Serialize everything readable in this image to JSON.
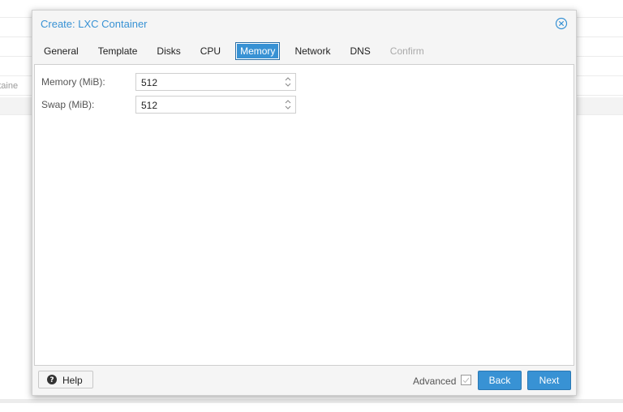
{
  "background": {
    "row_text": "ontaine"
  },
  "window": {
    "title": "Create: LXC Container"
  },
  "tabs": [
    {
      "label": "General",
      "state": "normal"
    },
    {
      "label": "Template",
      "state": "normal"
    },
    {
      "label": "Disks",
      "state": "normal"
    },
    {
      "label": "CPU",
      "state": "normal"
    },
    {
      "label": "Memory",
      "state": "active"
    },
    {
      "label": "Network",
      "state": "normal"
    },
    {
      "label": "DNS",
      "state": "normal"
    },
    {
      "label": "Confirm",
      "state": "disabled"
    }
  ],
  "form": {
    "memory": {
      "label": "Memory (MiB):",
      "value": "512"
    },
    "swap": {
      "label": "Swap (MiB):",
      "value": "512"
    }
  },
  "footer": {
    "help_label": "Help",
    "advanced_label": "Advanced",
    "advanced_checked": false,
    "back_label": "Back",
    "next_label": "Next"
  },
  "colors": {
    "accent": "#3892d4",
    "title": "#3892d4",
    "disabled_text": "#aaaaaa"
  },
  "icons": {
    "close": "close-circle-icon",
    "help": "question-circle-icon",
    "spinner": "up-down-arrows-icon",
    "checkbox": "checkbox-icon"
  }
}
